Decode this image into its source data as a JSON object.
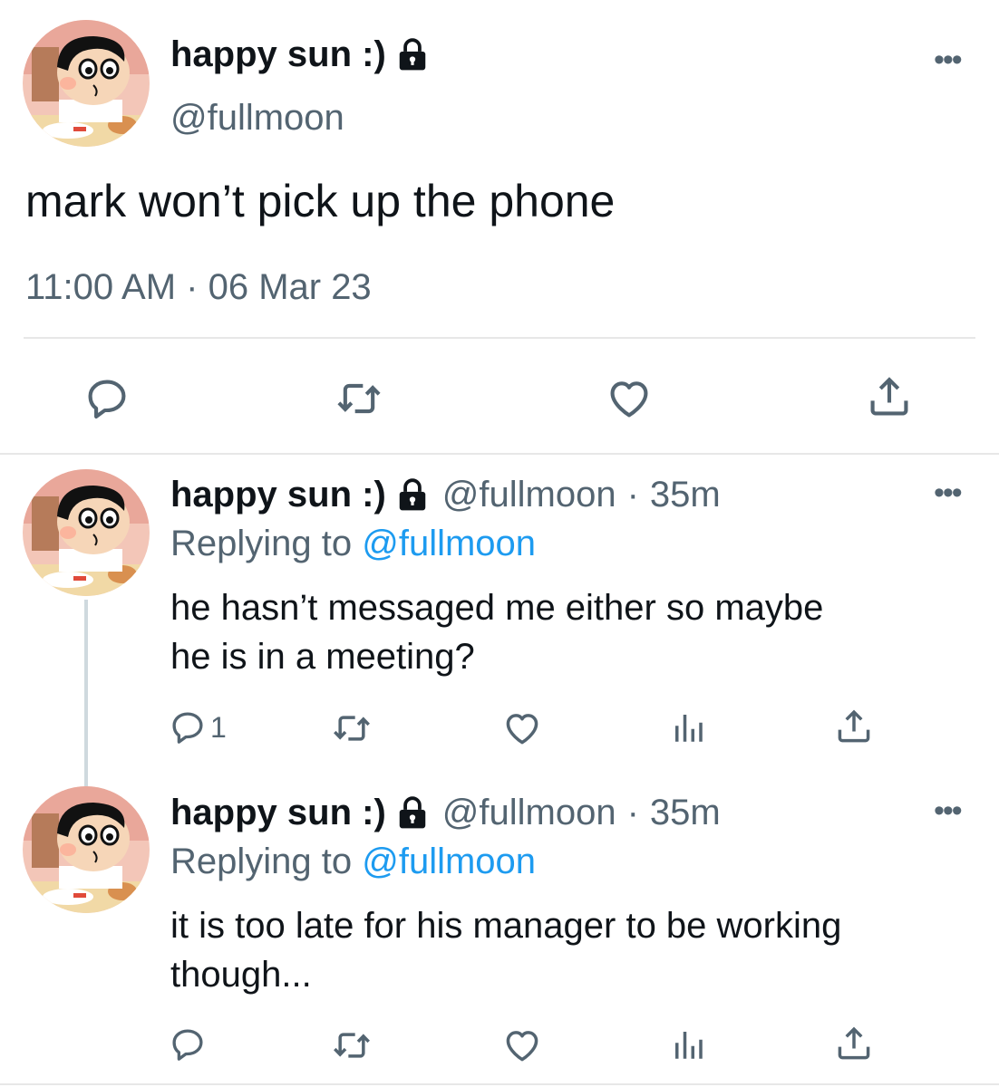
{
  "main_tweet": {
    "display_name": "happy sun :)",
    "handle": "@fullmoon",
    "text": "mark won’t pick up the phone",
    "timestamp": "11:00 AM · 06 Mar 23",
    "icons": [
      "lock-icon",
      "more-icon",
      "reply-icon",
      "retweet-icon",
      "like-icon",
      "share-icon"
    ]
  },
  "replies": [
    {
      "display_name": "happy sun :)",
      "handle": "@fullmoon",
      "separator": "·",
      "time": "35m",
      "replying_prefix": "Replying to",
      "replying_handle": "@fullmoon",
      "text_line1": "he hasn’t messaged me either so maybe",
      "text_line2": "he is in a meeting?",
      "reply_count": "1"
    },
    {
      "display_name": "happy sun :)",
      "handle": "@fullmoon",
      "separator": "·",
      "time": "35m",
      "replying_prefix": "Replying to",
      "replying_handle": "@fullmoon",
      "text_line1": "it is too late for his manager to be working",
      "text_line2": "though...",
      "reply_count": ""
    }
  ],
  "colors": {
    "text": "#0f1419",
    "secondary": "#536471",
    "link": "#1d9bf0",
    "divider": "#e7e7e7"
  }
}
